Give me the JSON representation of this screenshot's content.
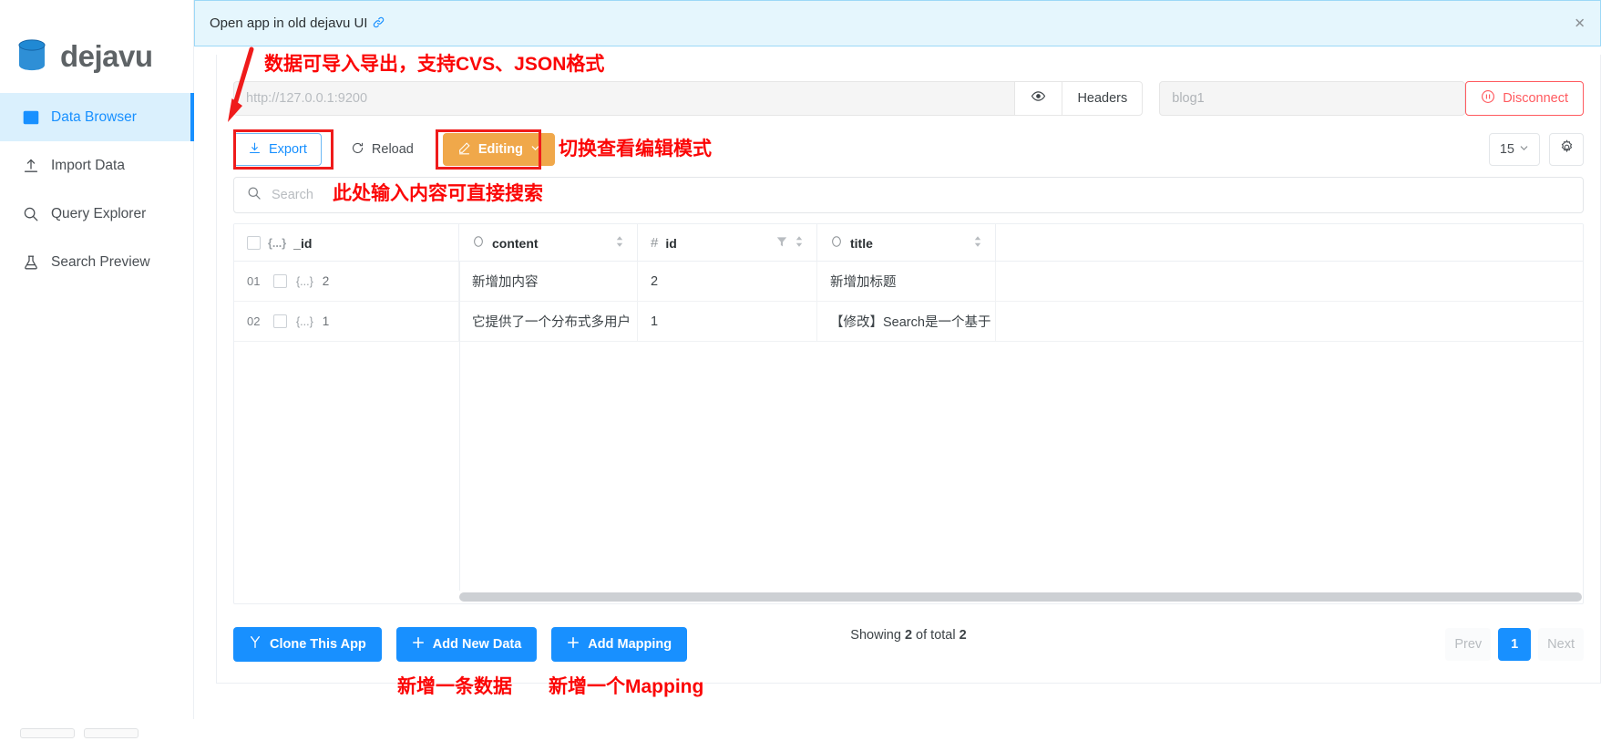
{
  "brand": {
    "name": "dejavu",
    "logo_icon": "database-cylinder-icon"
  },
  "sidebar": {
    "items": [
      {
        "label": "Data Browser",
        "icon": "table-grid-icon",
        "active": true
      },
      {
        "label": "Import Data",
        "icon": "upload-icon",
        "active": false
      },
      {
        "label": "Query Explorer",
        "icon": "search-icon",
        "active": false
      },
      {
        "label": "Search Preview",
        "icon": "flask-icon",
        "active": false
      }
    ]
  },
  "banner": {
    "text": "Open app in old dejavu UI",
    "link_icon": "link-icon",
    "close_icon": "close-icon"
  },
  "connection": {
    "url_placeholder": "http://127.0.0.1:9200",
    "url_value": "",
    "eye_icon": "eye-icon",
    "headers_label": "Headers",
    "index_placeholder": "blog1",
    "index_value": "",
    "disconnect_label": "Disconnect",
    "disconnect_icon": "pause-circle-icon",
    "disconnect_color": "#ff5a5f"
  },
  "toolbar": {
    "export_label": "Export",
    "export_icon": "download-icon",
    "export_color": "#1890ff",
    "reload_label": "Reload",
    "reload_icon": "refresh-icon",
    "editing_label": "Editing",
    "editing_icon": "pencil-icon",
    "editing_caret": "chevron-down-icon",
    "editing_color": "#f0a84a",
    "page_size": "15",
    "page_size_caret": "chevron-down-icon",
    "settings_icon": "gear-icon"
  },
  "search": {
    "placeholder": "Search",
    "value": "",
    "icon": "search-icon"
  },
  "table": {
    "columns": [
      {
        "label": "_id",
        "type_icon": "object-braces-icon",
        "type_glyph": "{...}",
        "sortable": false,
        "filterable": false,
        "has_checkbox": true
      },
      {
        "label": "content",
        "type_icon": "text-type-icon",
        "type_glyph": "",
        "sortable": true,
        "filterable": false,
        "has_checkbox": false
      },
      {
        "label": "id",
        "type_icon": "number-hash-icon",
        "type_glyph": "#",
        "sortable": true,
        "filterable": true,
        "has_checkbox": false
      },
      {
        "label": "title",
        "type_icon": "text-type-icon",
        "type_glyph": "",
        "sortable": true,
        "filterable": false,
        "has_checkbox": false
      }
    ],
    "rows": [
      {
        "num": "01",
        "_id": "2",
        "content": "新增加内容",
        "id": "2",
        "title": "新增加标题"
      },
      {
        "num": "02",
        "_id": "1",
        "content": "它提供了一个分布式多用户",
        "id": "1",
        "title": "【修改】Search是一个基于"
      }
    ]
  },
  "footer": {
    "clone_label": "Clone This App",
    "clone_icon": "fork-icon",
    "add_data_label": "Add New Data",
    "add_data_icon": "plus-icon",
    "add_mapping_label": "Add Mapping",
    "add_mapping_icon": "plus-icon",
    "showing_prefix": "Showing ",
    "showing_count": "2",
    "showing_middle": " of total ",
    "showing_total": "2",
    "prev_label": "Prev",
    "page_label": "1",
    "next_label": "Next"
  },
  "annotations": [
    {
      "id": "export-note",
      "text": "数据可导入导出，支持CVS、JSON格式"
    },
    {
      "id": "editing-note",
      "text": "切换查看编辑模式"
    },
    {
      "id": "search-note",
      "text": "此处输入内容可直接搜索"
    },
    {
      "id": "adddata-note",
      "text": "新增一条数据"
    },
    {
      "id": "mapping-note",
      "text": "新增一个Mapping"
    }
  ]
}
